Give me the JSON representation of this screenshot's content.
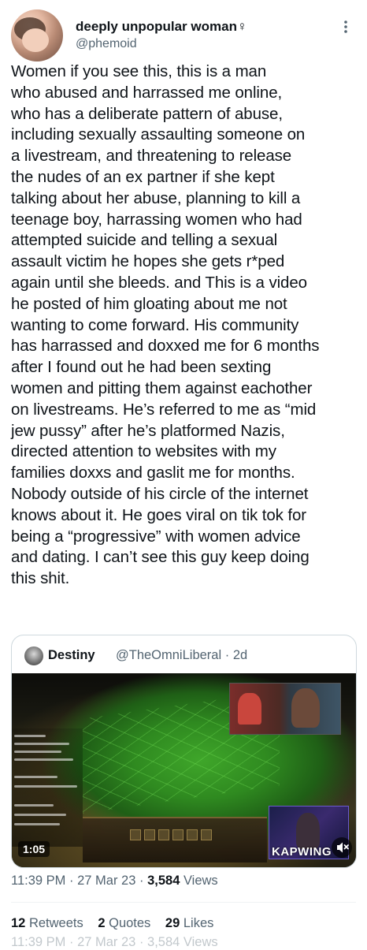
{
  "author": {
    "display_name": "deeply unpopular woman♀",
    "handle": "@phemoid"
  },
  "tweet": {
    "text": "Women if you see this, this is a man\nwho abused and harrassed me online,\nwho has a deliberate pattern of abuse,\nincluding sexually assaulting someone on\na livestream, and threatening to release\nthe nudes of an ex partner if she kept\ntalking about her abuse, planning to kill a\nteenage boy, harrassing women who had\nattempted suicide and telling a sexual\nassault victim he hopes she gets r*ped\nagain until she bleeds. and This is a video\nhe posted of him gloating about me not\nwanting to come forward. His community\nhas harrassed and doxxed me for 6 months\nafter I found out he had been sexting\nwomen and pitting them against eachother\non livestreams. He’s referred to me as “mid\njew pussy” after he’s platformed Nazis,\ndirected attention to websites with my\nfamilies doxxs and gaslit me for months.\nNobody outside of his circle of the internet\nknows about it. He goes viral on tik tok for\nbeing a “progressive” with women advice\nand dating.  I can’t see this guy keep doing\nthis shit."
  },
  "quote": {
    "display_name": "Destiny",
    "handle": "@TheOmniLiberal",
    "separator": "·",
    "time": "2d",
    "video": {
      "duration": "1:05",
      "watermark": "KAPWING"
    }
  },
  "meta": {
    "time": "11:39 PM",
    "separator": "·",
    "date": "27 Mar 23",
    "views_count": "3,584",
    "views_label": "Views"
  },
  "stats": {
    "retweets_count": "12",
    "retweets_label": "Retweets",
    "quotes_count": "2",
    "quotes_label": "Quotes",
    "likes_count": "29",
    "likes_label": "Likes"
  },
  "ghost": {
    "text": "11:39 PM · 27 Mar 23 · 3,584 Views"
  },
  "icons": {
    "more": "more-horizontal-icon",
    "mute": "mute-icon"
  },
  "colors": {
    "text_primary": "#0f1419",
    "text_secondary": "#536471",
    "border": "#cfd9de"
  }
}
